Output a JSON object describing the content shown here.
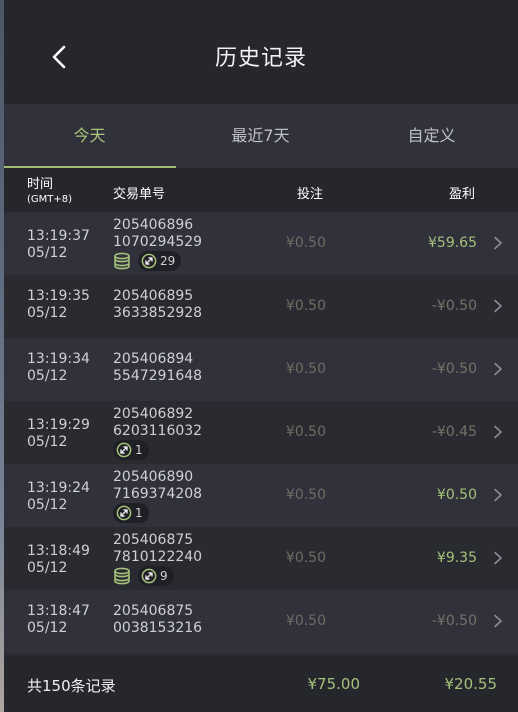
{
  "header": {
    "title": "历史记录"
  },
  "tabs": [
    {
      "label": "今天"
    },
    {
      "label": "最近7天"
    },
    {
      "label": "自定义"
    }
  ],
  "columns": {
    "time": "时间",
    "timezone": "(GMT+8)",
    "order": "交易单号",
    "stake": "投注",
    "profit": "盈利"
  },
  "rows": [
    {
      "time": "13:19:37",
      "date": "05/12",
      "order1": "205406896",
      "order2": "1070294529",
      "stake": "¥0.50",
      "profit": "¥59.65",
      "positive": true,
      "coin": true,
      "count": "29"
    },
    {
      "time": "13:19:35",
      "date": "05/12",
      "order1": "205406895",
      "order2": "3633852928",
      "stake": "¥0.50",
      "profit": "-¥0.50",
      "positive": false,
      "coin": false,
      "count": ""
    },
    {
      "time": "13:19:34",
      "date": "05/12",
      "order1": "205406894",
      "order2": "5547291648",
      "stake": "¥0.50",
      "profit": "-¥0.50",
      "positive": false,
      "coin": false,
      "count": ""
    },
    {
      "time": "13:19:29",
      "date": "05/12",
      "order1": "205406892",
      "order2": "6203116032",
      "stake": "¥0.50",
      "profit": "-¥0.45",
      "positive": false,
      "coin": false,
      "count": "1"
    },
    {
      "time": "13:19:24",
      "date": "05/12",
      "order1": "205406890",
      "order2": "7169374208",
      "stake": "¥0.50",
      "profit": "¥0.50",
      "positive": true,
      "coin": false,
      "count": "1"
    },
    {
      "time": "13:18:49",
      "date": "05/12",
      "order1": "205406875",
      "order2": "7810122240",
      "stake": "¥0.50",
      "profit": "¥9.35",
      "positive": true,
      "coin": true,
      "count": "9"
    },
    {
      "time": "13:18:47",
      "date": "05/12",
      "order1": "205406875",
      "order2": "0038153216",
      "stake": "¥0.50",
      "profit": "-¥0.50",
      "positive": false,
      "coin": false,
      "count": ""
    }
  ],
  "footer": {
    "total_label": "共150条记录",
    "stake_total": "¥75.00",
    "profit_total": "¥20.55"
  },
  "colors": {
    "accent": "#a4c17a",
    "muted": "#717467",
    "background": "#2a2b31"
  },
  "icons": {
    "back": "chevron-left-icon",
    "row_arrow": "chevron-right-icon",
    "coin": "coin-stack-icon",
    "swap": "swap-arrows-icon"
  }
}
